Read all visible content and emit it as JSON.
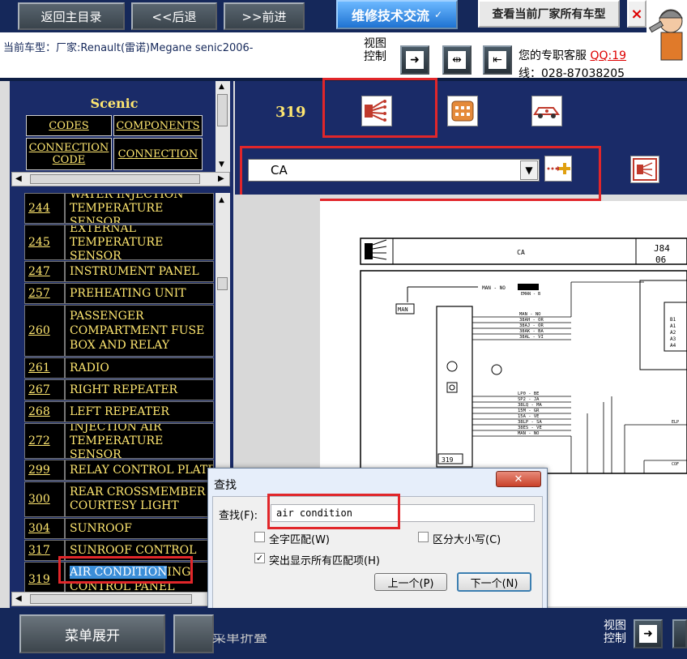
{
  "top": {
    "back_home": "返回主目录",
    "back": "<<后退",
    "forward": ">>前进",
    "tech_exchange": "维修技术交流",
    "view_all_models": "查看当前厂家所有车型",
    "close": "×"
  },
  "info": {
    "current_car": "当前车型：厂家:Renault(雷诺)Megane senic2006-",
    "view_control": "视图控制",
    "service_label": "您的专职客服",
    "qq": "QQ:19",
    "phone": "线：028-87038205"
  },
  "nav": {
    "title": "Scenic",
    "codes": "CODES",
    "components": "COMPONENTS",
    "connection_code": "CONNECTION CODE",
    "connection": "CONNECTION"
  },
  "list": [
    {
      "num": "244",
      "desc": "WATER INJECTION TEMPERATURE SENSOR"
    },
    {
      "num": "245",
      "desc": "EXTERNAL TEMPERATURE SENSOR"
    },
    {
      "num": "247",
      "desc": "INSTRUMENT PANEL"
    },
    {
      "num": "257",
      "desc": "PREHEATING UNIT"
    },
    {
      "num": "260",
      "desc": "PASSENGER COMPARTMENT FUSE BOX AND RELAY"
    },
    {
      "num": "261",
      "desc": "RADIO"
    },
    {
      "num": "267",
      "desc": "RIGHT REPEATER"
    },
    {
      "num": "268",
      "desc": "LEFT REPEATER"
    },
    {
      "num": "272",
      "desc": "INJECTION AIR TEMPERATURE SENSOR"
    },
    {
      "num": "299",
      "desc": "RELAY CONTROL PLATE"
    },
    {
      "num": "300",
      "desc": "REAR CROSSMEMBER COURTESY LIGHT"
    },
    {
      "num": "304",
      "desc": "SUNROOF"
    },
    {
      "num": "317",
      "desc": "SUNROOF CONTROL"
    },
    {
      "num": "319",
      "desc_hl": "AIR CONDITION",
      "desc_rest": "ING",
      "desc_line2": "CONTROL PANEL"
    }
  ],
  "component": {
    "number": "319",
    "connector": "CA"
  },
  "diagram": {
    "header_label": "CA",
    "code_right_1": "J84",
    "code_right_2": "06",
    "box_label": "319",
    "top_wire": "MAN - NO",
    "top_component": "EMAN - B",
    "ground_label": "MAN",
    "pin_group_1": [
      "MAN - NO",
      "38AH - OR",
      "38AJ - OR",
      "38AK - BA",
      "38AL - VI"
    ],
    "pin_group_2": [
      "LP0 - BE",
      "SP2 - JA",
      "38LQ - MA",
      "15M - GR",
      "15A - VE",
      "38LP - SA",
      "38ES - VE",
      "MAN - NO"
    ],
    "right_pins": [
      "B1",
      "A1",
      "A2",
      "A3",
      "A4"
    ],
    "far_right_1": "ELP",
    "far_right_2": "COF"
  },
  "find_dialog": {
    "title": "查找",
    "find_label": "查找(F):",
    "query": "air condition",
    "whole_word": "全字匹配(W)",
    "match_case": "区分大小写(C)",
    "highlight_all": "突出显示所有匹配项(H)",
    "prev": "上一个(P)",
    "next": "下一个(N)"
  },
  "bottom": {
    "expand_menu": "菜单展开",
    "collapse_menu": "菜单折叠",
    "view_control": "视图控制"
  },
  "colors": {
    "panel": "#1a2b68",
    "label": "#ffe770",
    "highlight_box": "#e1262a"
  }
}
